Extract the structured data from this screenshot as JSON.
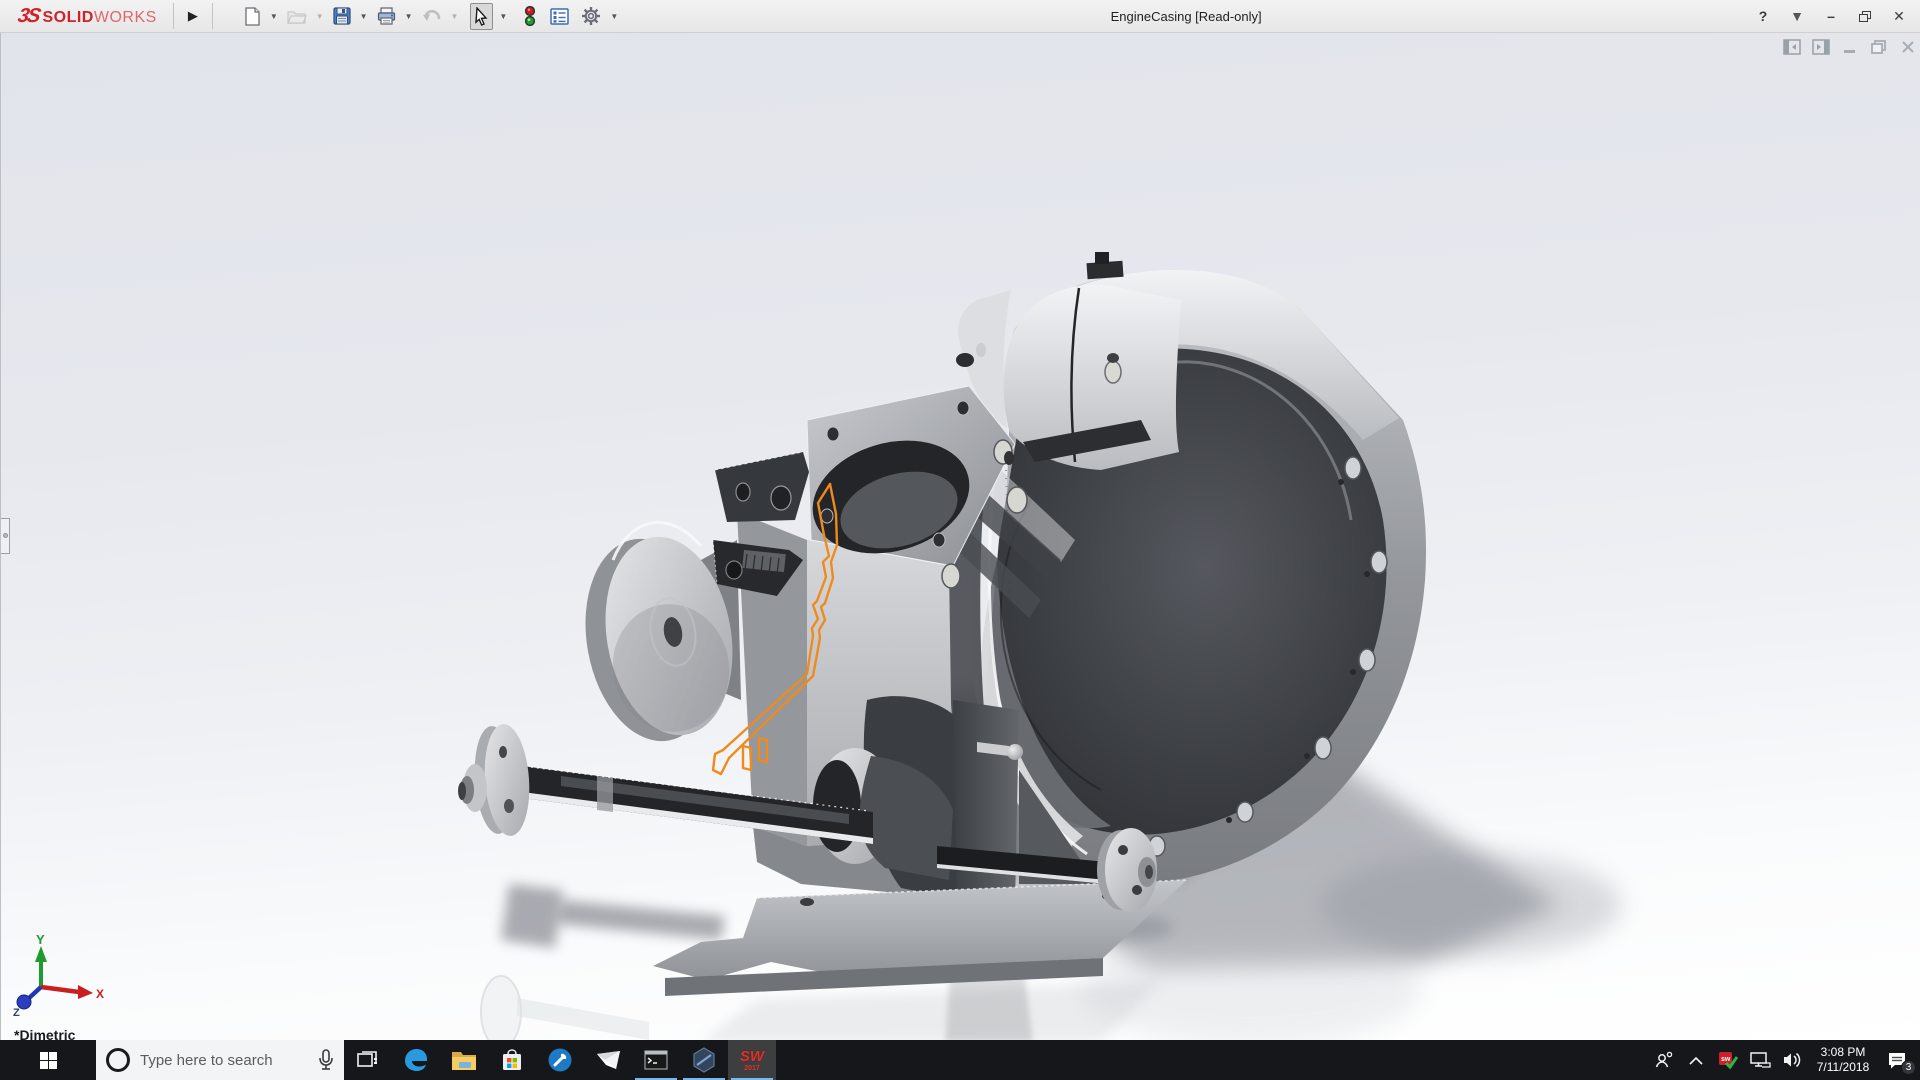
{
  "titlebar": {
    "logo": {
      "mark": "3S",
      "brand_bold": "SOLID",
      "brand_light": "WORKS"
    },
    "expand_arrow": "▶",
    "toolbar_icons": [
      "new-document",
      "open",
      "save",
      "print",
      "undo",
      "select",
      "rebuild-traffic-light",
      "task-pane-list",
      "options-gear"
    ],
    "document_title": "EngineCasing [Read-only]",
    "help_label": "?",
    "minimize_label": "–",
    "close_label": "✕"
  },
  "doc_window_controls": [
    "collapse-left-pane",
    "collapse-right-pane",
    "minimize",
    "restore",
    "close"
  ],
  "viewport": {
    "view_orientation_label": "*Dimetric",
    "triad_labels": {
      "x": "X",
      "y": "Y",
      "z": "Z"
    },
    "model_description": "engine-casing-assembly-with-orange-highlighted-sketch"
  },
  "taskbar": {
    "search": {
      "placeholder": "Type here to search"
    },
    "app_icons": [
      "start",
      "task-view",
      "edge",
      "file-explorer",
      "store",
      "support-wrench",
      "mail",
      "command-prompt",
      "hexagon-app",
      "solidworks-2017"
    ],
    "solidworks_icon": {
      "text": "SW",
      "year": "2017"
    },
    "tray_icons": [
      "people",
      "hidden-icons-chevron",
      "solidworks-monitor",
      "network",
      "volume",
      "clock",
      "action-center"
    ],
    "tray": {
      "time": "3:08 PM",
      "date": "7/11/2018",
      "notification_badge": "3",
      "sw_monitor_text": "sw"
    }
  },
  "colors": {
    "sketch_highlight": "#F08A1D",
    "logo_red": "#D1202A",
    "taskbar_background": "#16171A",
    "taskbar_accent": "#76B9ED",
    "viewport_top": "#E2E4EB",
    "viewport_bottom": "#FFFFFF"
  }
}
